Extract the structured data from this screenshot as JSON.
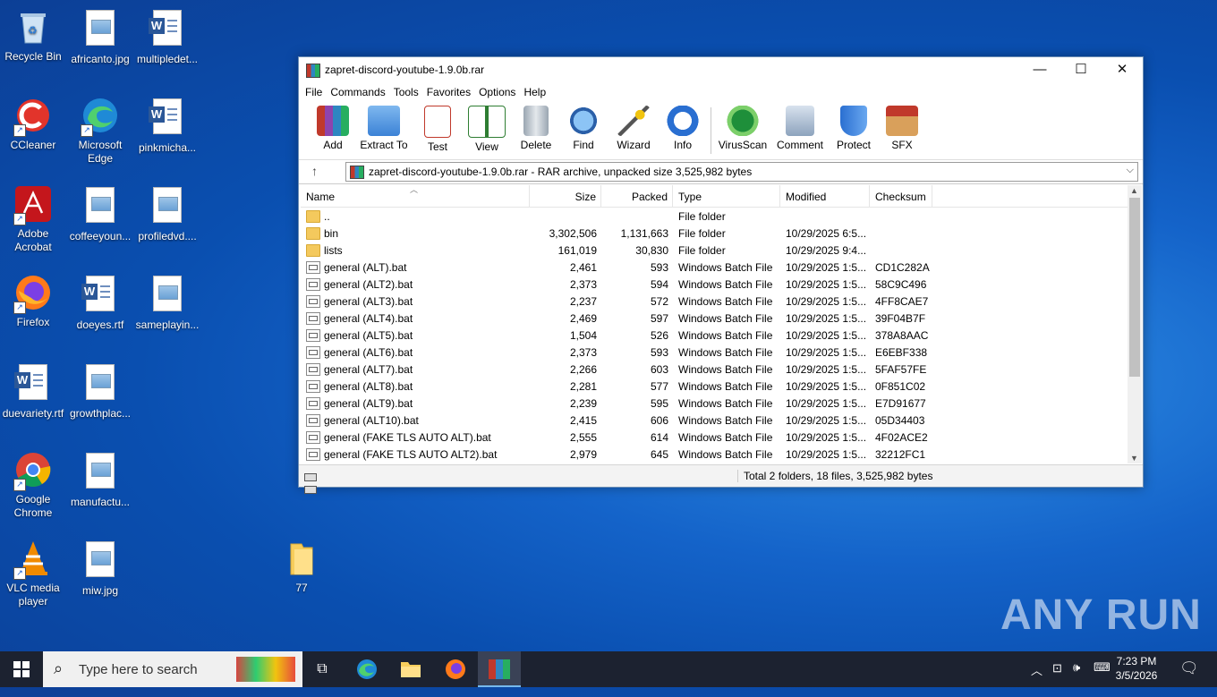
{
  "desktop": {
    "icons": [
      {
        "label": "Recycle Bin"
      },
      {
        "label": "africanto.jpg"
      },
      {
        "label": "multipledet..."
      },
      {
        "label": "CCleaner"
      },
      {
        "label": "Microsoft Edge"
      },
      {
        "label": "pinkmicha..."
      },
      {
        "label": "Adobe Acrobat"
      },
      {
        "label": "coffeeyoun..."
      },
      {
        "label": "profiledvd...."
      },
      {
        "label": "Firefox"
      },
      {
        "label": "doeyes.rtf"
      },
      {
        "label": "sameplayin..."
      },
      {
        "label": "duevariety.rtf"
      },
      {
        "label": "growthplac..."
      },
      {
        "label": "Google Chrome"
      },
      {
        "label": "manufactu..."
      },
      {
        "label": "VLC media player"
      },
      {
        "label": "miw.jpg"
      },
      {
        "label": "77"
      }
    ]
  },
  "window": {
    "title": "zapret-discord-youtube-1.9.0b.rar",
    "menu": [
      "File",
      "Commands",
      "Tools",
      "Favorites",
      "Options",
      "Help"
    ],
    "toolbar": [
      "Add",
      "Extract To",
      "Test",
      "View",
      "Delete",
      "Find",
      "Wizard",
      "Info",
      "VirusScan",
      "Comment",
      "Protect",
      "SFX"
    ],
    "address": "zapret-discord-youtube-1.9.0b.rar - RAR archive, unpacked size 3,525,982 bytes",
    "columns": [
      "Name",
      "Size",
      "Packed",
      "Type",
      "Modified",
      "Checksum"
    ],
    "rows": [
      {
        "name": "..",
        "size": "",
        "packed": "",
        "type": "File folder",
        "modified": "",
        "checksum": "",
        "kind": "folder"
      },
      {
        "name": "bin",
        "size": "3,302,506",
        "packed": "1,131,663",
        "type": "File folder",
        "modified": "10/29/2025 6:5...",
        "checksum": "",
        "kind": "folder"
      },
      {
        "name": "lists",
        "size": "161,019",
        "packed": "30,830",
        "type": "File folder",
        "modified": "10/29/2025 9:4...",
        "checksum": "",
        "kind": "folder"
      },
      {
        "name": "general (ALT).bat",
        "size": "2,461",
        "packed": "593",
        "type": "Windows Batch File",
        "modified": "10/29/2025 1:5...",
        "checksum": "CD1C282A",
        "kind": "bat"
      },
      {
        "name": "general (ALT2).bat",
        "size": "2,373",
        "packed": "594",
        "type": "Windows Batch File",
        "modified": "10/29/2025 1:5...",
        "checksum": "58C9C496",
        "kind": "bat"
      },
      {
        "name": "general (ALT3).bat",
        "size": "2,237",
        "packed": "572",
        "type": "Windows Batch File",
        "modified": "10/29/2025 1:5...",
        "checksum": "4FF8CAE7",
        "kind": "bat"
      },
      {
        "name": "general (ALT4).bat",
        "size": "2,469",
        "packed": "597",
        "type": "Windows Batch File",
        "modified": "10/29/2025 1:5...",
        "checksum": "39F04B7F",
        "kind": "bat"
      },
      {
        "name": "general (ALT5).bat",
        "size": "1,504",
        "packed": "526",
        "type": "Windows Batch File",
        "modified": "10/29/2025 1:5...",
        "checksum": "378A8AAC",
        "kind": "bat"
      },
      {
        "name": "general (ALT6).bat",
        "size": "2,373",
        "packed": "593",
        "type": "Windows Batch File",
        "modified": "10/29/2025 1:5...",
        "checksum": "E6EBF338",
        "kind": "bat"
      },
      {
        "name": "general (ALT7).bat",
        "size": "2,266",
        "packed": "603",
        "type": "Windows Batch File",
        "modified": "10/29/2025 1:5...",
        "checksum": "5FAF57FE",
        "kind": "bat"
      },
      {
        "name": "general (ALT8).bat",
        "size": "2,281",
        "packed": "577",
        "type": "Windows Batch File",
        "modified": "10/29/2025 1:5...",
        "checksum": "0F851C02",
        "kind": "bat"
      },
      {
        "name": "general (ALT9).bat",
        "size": "2,239",
        "packed": "595",
        "type": "Windows Batch File",
        "modified": "10/29/2025 1:5...",
        "checksum": "E7D91677",
        "kind": "bat"
      },
      {
        "name": "general (ALT10).bat",
        "size": "2,415",
        "packed": "606",
        "type": "Windows Batch File",
        "modified": "10/29/2025 1:5...",
        "checksum": "05D34403",
        "kind": "bat"
      },
      {
        "name": "general (FAKE TLS AUTO ALT).bat",
        "size": "2,555",
        "packed": "614",
        "type": "Windows Batch File",
        "modified": "10/29/2025 1:5...",
        "checksum": "4F02ACE2",
        "kind": "bat"
      },
      {
        "name": "general (FAKE TLS AUTO ALT2).bat",
        "size": "2,979",
        "packed": "645",
        "type": "Windows Batch File",
        "modified": "10/29/2025 1:5...",
        "checksum": "32212FC1",
        "kind": "bat"
      }
    ],
    "status_total": "Total 2 folders, 18 files, 3,525,982 bytes"
  },
  "taskbar": {
    "search_placeholder": "Type here to search",
    "time": "7:23 PM",
    "date": "3/5/2026"
  },
  "watermark": "ANY RUN"
}
